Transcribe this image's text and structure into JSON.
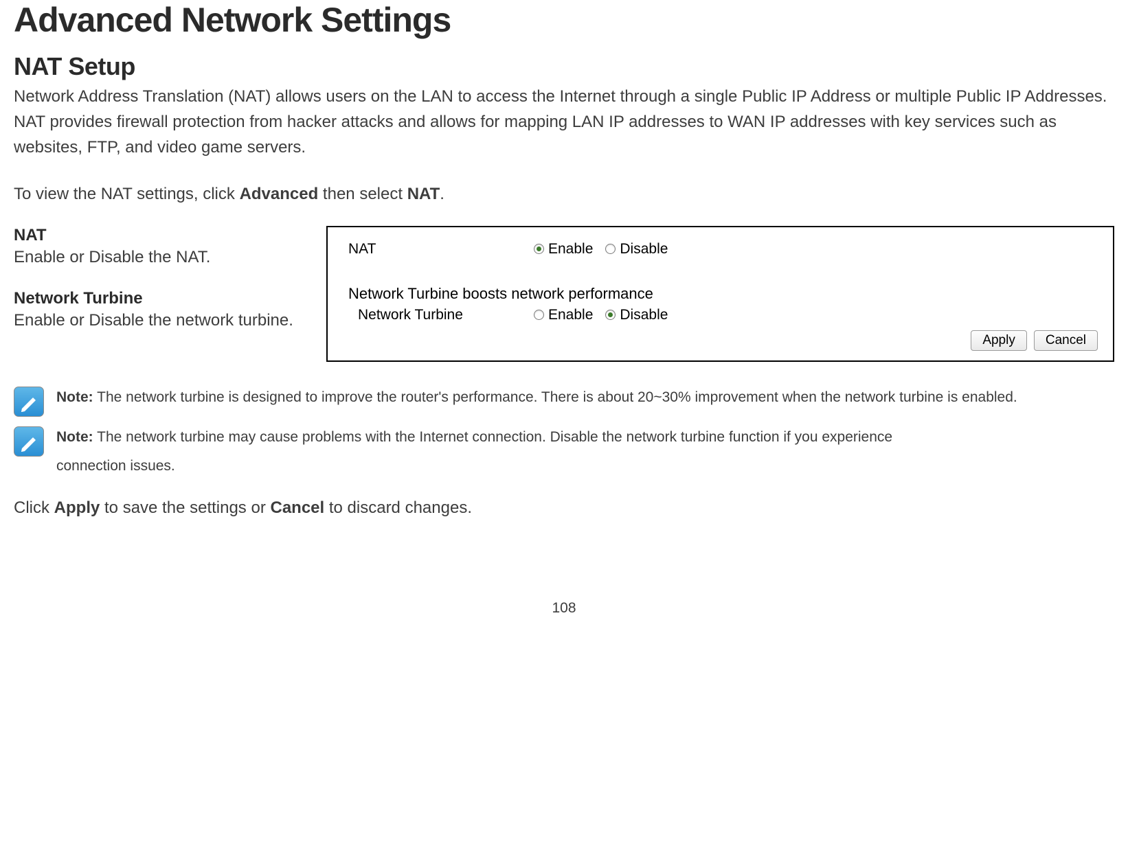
{
  "page": {
    "title": "Advanced Network Settings",
    "section": "NAT Setup",
    "intro": "Network Address Translation (NAT) allows users on the LAN to access the Internet through a single Public IP Address or multiple Public IP Addresses. NAT provides firewall protection from hacker attacks and allows for mapping LAN IP addresses to WAN IP addresses with key services such as websites, FTP, and video game servers.",
    "instruction_pre": "To view the NAT settings, click ",
    "instruction_bold1": "Advanced",
    "instruction_mid": " then select ",
    "instruction_bold2": "NAT",
    "instruction_post": "."
  },
  "settings": {
    "nat": {
      "title": "NAT",
      "desc": "Enable or Disable the NAT."
    },
    "turbine": {
      "title": "Network Turbine",
      "desc": "Enable or Disable the network turbine."
    }
  },
  "panel": {
    "nat_label": "NAT",
    "nat_enable": "Enable",
    "nat_disable": "Disable",
    "turbine_header": "Network Turbine boosts network performance",
    "turbine_label": "Network Turbine",
    "turbine_enable": "Enable",
    "turbine_disable": "Disable",
    "apply": "Apply",
    "cancel": "Cancel"
  },
  "notes": {
    "note1_bold": "Note:",
    "note1_text": " The network turbine is designed to improve the router's performance. There is about 20~30% improvement when the network turbine is enabled.",
    "note2_bold": "Note:",
    "note2_text_a": " The network turbine may cause problems with the Internet connection. Disable the network turbine function if you experience",
    "note2_text_b": "connection issues."
  },
  "closing": {
    "pre": "Click ",
    "apply": "Apply",
    "mid": " to save the settings or ",
    "cancel": "Cancel",
    "post": " to discard changes."
  },
  "page_number": "108"
}
